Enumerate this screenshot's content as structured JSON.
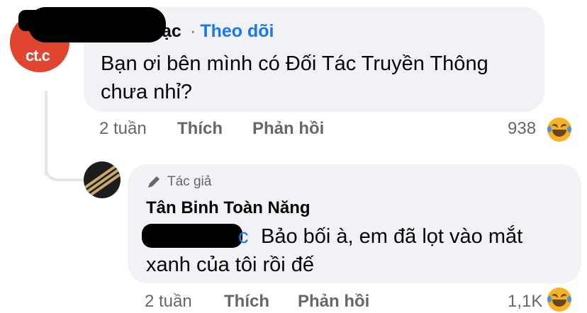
{
  "comments": [
    {
      "name_partial": "ạc",
      "follow_separator": "·",
      "follow_label": "Theo dõi",
      "text": "Bạn ơi bên mình có Đối Tác Truyền Thông chưa nhỉ?",
      "avatar_text": "ct.c",
      "time": "2 tuần",
      "like_label": "Thích",
      "reply_label": "Phản hồi",
      "reaction_count": "938",
      "reaction_icon": "haha-emoji-icon"
    },
    {
      "author_badge": "Tác giả",
      "author_badge_icon": "pen-icon",
      "name": "Tân Binh Toàn Năng",
      "mention_tail": "c",
      "text": "Bảo bối à, em đã lọt vào mắt xanh của tôi rồi đế",
      "time": "2 tuần",
      "like_label": "Thích",
      "reply_label": "Phản hồi",
      "reaction_count": "1,1K",
      "reaction_icon": "haha-emoji-icon"
    }
  ],
  "colors": {
    "link": "#1877f2",
    "muted": "#65676b",
    "bubble": "#f0f2f5",
    "avatar1_bg": "#e0452f",
    "emoji_yellow": "#f7b125"
  }
}
